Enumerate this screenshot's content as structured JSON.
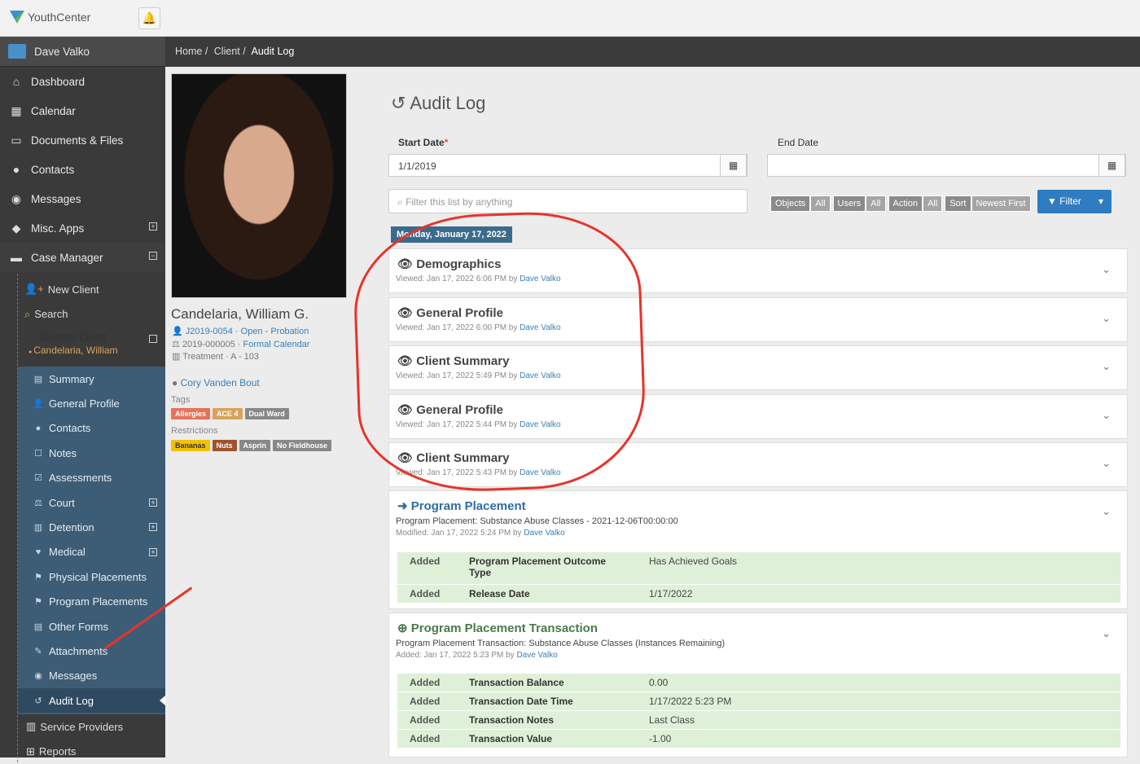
{
  "app": {
    "name": "YouthCenter"
  },
  "breadcrumb": [
    "Home /",
    "Client /",
    "Audit Log"
  ],
  "sidebar": {
    "user": "Dave Valko",
    "items": [
      "Dashboard",
      "Calendar",
      "Documents & Files",
      "Contacts",
      "Messages",
      "Misc. Apps",
      "Case Manager"
    ],
    "case_items": [
      "New Client",
      "Search"
    ],
    "current_client_label": "Current Client",
    "current_client_name": "Candelaria, William",
    "client_items": [
      "Summary",
      "General Profile",
      "Contacts",
      "Notes",
      "Assessments",
      "Court",
      "Detention",
      "Medical",
      "Physical Placements",
      "Program Placements",
      "Other Forms",
      "Attachments",
      "Messages",
      "Audit Log"
    ],
    "after_items": [
      "Service Providers",
      "Reports"
    ]
  },
  "client": {
    "name": "Candelaria, William G.",
    "case": "J2019-0054 · Open - Probation",
    "court_id": "2019-000005 · ",
    "court_link": "Formal Calendar",
    "housing": "Treatment · A - 103",
    "worker": "Cory Vanden Bout",
    "tags_label": "Tags",
    "tags": [
      "Allergies",
      "ACE 4",
      "Dual Ward"
    ],
    "restrictions_label": "Restrictions",
    "restrictions": [
      "Bananas",
      "Nuts",
      "Asprin",
      "No Fieldhouse"
    ]
  },
  "page": {
    "title": "Audit Log",
    "start_label": "Start Date",
    "start_value": "1/1/2019",
    "end_label": "End Date",
    "filter_placeholder": "Filter this list by anything",
    "chips": [
      [
        "Objects",
        "All"
      ],
      [
        "Users",
        "All"
      ],
      [
        "Action",
        "All"
      ],
      [
        "Sort",
        "Newest First"
      ]
    ],
    "filter_btn": "Filter",
    "day": "Monday, January 17, 2022"
  },
  "entries": [
    {
      "title": "Demographics",
      "meta": "Viewed: Jan 17, 2022 6:06 PM by ",
      "user": "Dave Valko"
    },
    {
      "title": "General Profile",
      "meta": "Viewed: Jan 17, 2022 6:00 PM by ",
      "user": "Dave Valko"
    },
    {
      "title": "Client Summary",
      "meta": "Viewed: Jan 17, 2022 5:49 PM by ",
      "user": "Dave Valko"
    },
    {
      "title": "General Profile",
      "meta": "Viewed: Jan 17, 2022 5:44 PM by ",
      "user": "Dave Valko"
    },
    {
      "title": "Client Summary",
      "meta": "Viewed: Jan 17, 2022 5:43 PM by ",
      "user": "Dave Valko"
    }
  ],
  "placement": {
    "title": "Program Placement",
    "desc": "Program Placement: Substance Abuse Classes - 2021-12-06T00:00:00",
    "meta": "Modified: Jan 17, 2022 5:24 PM by ",
    "user": "Dave Valko",
    "rows": [
      [
        "Added",
        "Program Placement Outcome Type",
        "Has Achieved Goals"
      ],
      [
        "Added",
        "Release Date",
        "1/17/2022"
      ]
    ]
  },
  "transaction": {
    "title": "Program Placement Transaction",
    "desc": "Program Placement Transaction: Substance Abuse Classes (Instances Remaining)",
    "meta": "Added: Jan 17, 2022 5:23 PM by ",
    "user": "Dave Valko",
    "rows": [
      [
        "Added",
        "Transaction Balance",
        "0.00"
      ],
      [
        "Added",
        "Transaction Date Time",
        "1/17/2022 5:23 PM"
      ],
      [
        "Added",
        "Transaction Notes",
        "Last Class"
      ],
      [
        "Added",
        "Transaction Value",
        "-1.00"
      ]
    ]
  }
}
